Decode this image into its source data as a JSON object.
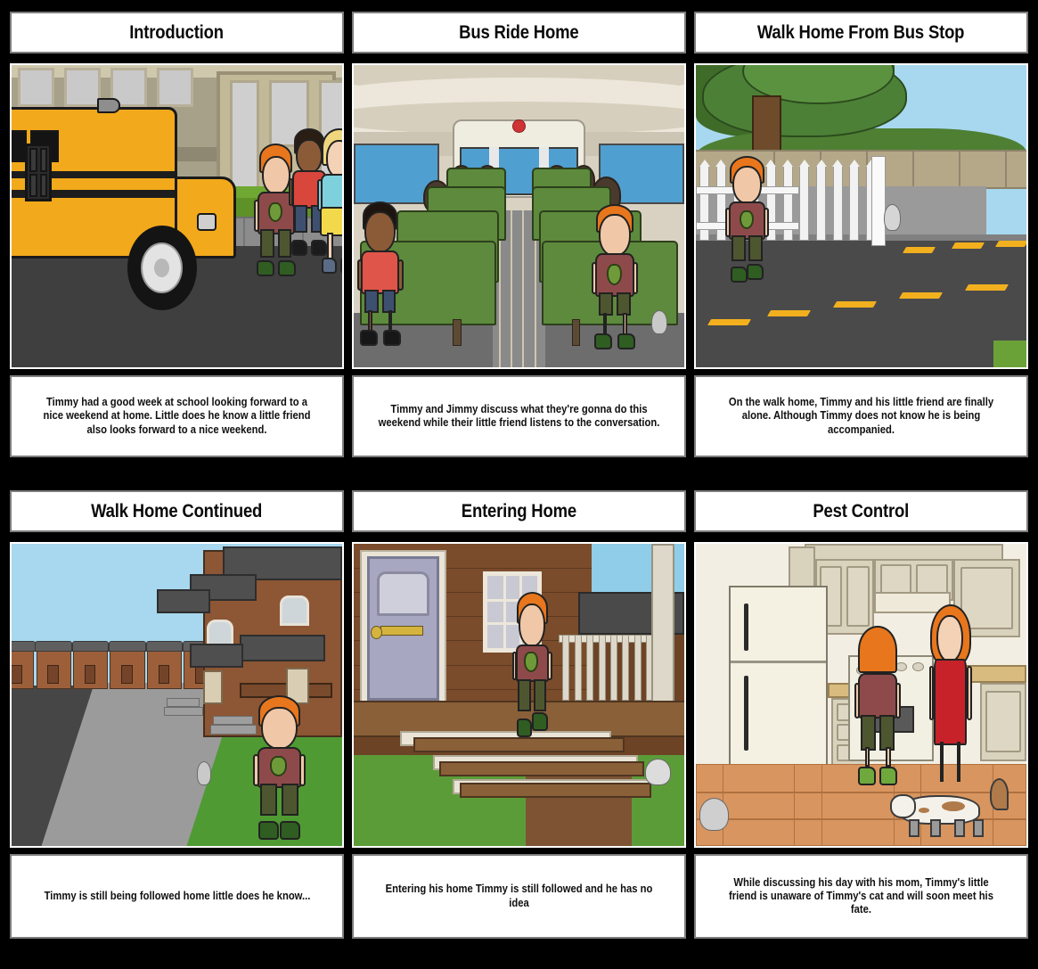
{
  "storyboard": {
    "layout": {
      "rows": 2,
      "columns": 3,
      "total_cells": 6
    },
    "cells": [
      {
        "index": 1,
        "title": "Introduction",
        "caption": "Timmy had a good week at school looking forward to a nice weekend at home. Little does he know a little friend also looks forward to a nice weekend.",
        "scene": "school-bus-outside-school",
        "scene_elements": [
          "yellow school bus",
          "school building",
          "three students on sidewalk",
          "white mouse on grass"
        ]
      },
      {
        "index": 2,
        "title": "Bus Ride Home",
        "caption": "Timmy and Jimmy discuss what they're gonna do this weekend while their little friend listens to the conversation.",
        "scene": "school-bus-interior",
        "scene_elements": [
          "green bus seats",
          "boy in red jersey number 8",
          "red-haired boy in alien shirt",
          "seated passengers",
          "mouse under seat"
        ]
      },
      {
        "index": 3,
        "title": "Walk Home From Bus Stop",
        "caption": "On the walk home, Timmy and his little friend are finally alone. Although Timmy does not know he is being accompanied.",
        "scene": "street-with-white-fence",
        "scene_elements": [
          "large tree",
          "white picket fence",
          "stone wall",
          "road with yellow dashes",
          "boy walking",
          "mouse on sidewalk"
        ]
      },
      {
        "index": 4,
        "title": "Walk Home Continued",
        "caption": "Timmy is still being followed home little does he know...",
        "scene": "suburban-street",
        "scene_elements": [
          "brick townhouses",
          "sidewalk",
          "green lawn",
          "boy walking",
          "mouse following"
        ]
      },
      {
        "index": 5,
        "title": "Entering Home",
        "caption": "Entering his home Timmy is still followed and he has no idea",
        "scene": "front-porch",
        "scene_elements": [
          "front door",
          "window",
          "porch deck",
          "stairs",
          "boy on steps",
          "mouse on grass"
        ]
      },
      {
        "index": 6,
        "title": "Pest Control",
        "caption": "While discussing his day with his mom, Timmy's little friend is unaware of Timmy's cat and will soon meet his fate.",
        "scene": "kitchen",
        "scene_elements": [
          "refrigerator",
          "cabinets",
          "stove",
          "boy",
          "mom in red dress",
          "cat",
          "mouse by fridge"
        ]
      }
    ]
  },
  "colors": {
    "page_background": "#000000",
    "panel_background": "#ffffff",
    "panel_border": "#7d7d7d",
    "image_border": "#ffffff",
    "text": "#101010",
    "bus_yellow": "#f2a91b",
    "seat_green": "#5d8a3c",
    "sky_blue": "#a7d8ef",
    "grass_green": "#5b9c38",
    "road_gray": "#464646",
    "mom_dress_red": "#c7222a",
    "hair_orange": "#e8761d",
    "shirt_maroon": "#8e4a4a",
    "road_dash_yellow": "#f2b01e"
  }
}
